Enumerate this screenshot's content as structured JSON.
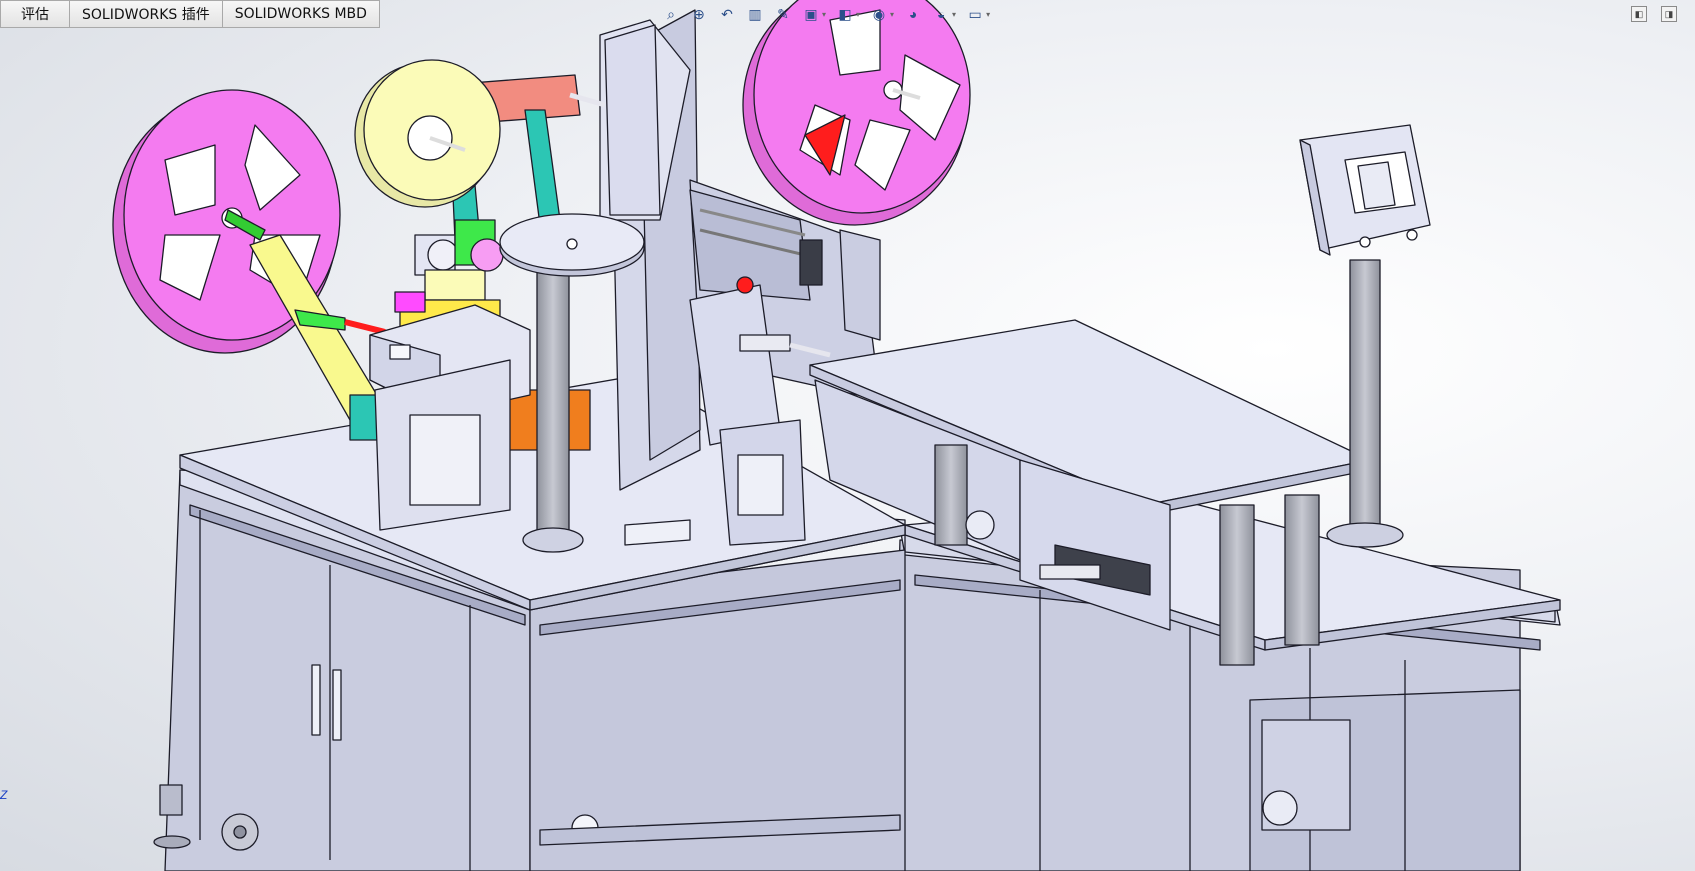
{
  "tabs": [
    {
      "label": "评估"
    },
    {
      "label": "SOLIDWORKS 插件"
    },
    {
      "label": "SOLIDWORKS MBD"
    }
  ],
  "heads_up_toolbar": {
    "icons": [
      "zoom-to-fit-icon",
      "zoom-area-icon",
      "previous-view-icon",
      "section-view-icon",
      "dynamic-annotation-icon",
      "view-orientation-icon",
      "display-style-icon",
      "hide-show-icon",
      "edit-appearance-icon",
      "apply-scene-icon",
      "view-settings-icon"
    ]
  },
  "window_controls": {
    "icons": [
      "restore-icon",
      "maximize-icon"
    ]
  },
  "triad_axis_label": "Z",
  "colors": {
    "sheet_metal": "#dcdff2",
    "sheet_metal_dark": "#a9aed0",
    "magenta_reel": "#f47bf0",
    "yellow_reel": "#fbfbb8",
    "salmon_arm": "#f28c80",
    "teal_arm": "#2cc6b4",
    "orange_plate": "#f07e1e",
    "green_part": "#3ee84a",
    "red_part": "#ff1d1d",
    "pillar_gray": "#9ea0aa"
  }
}
